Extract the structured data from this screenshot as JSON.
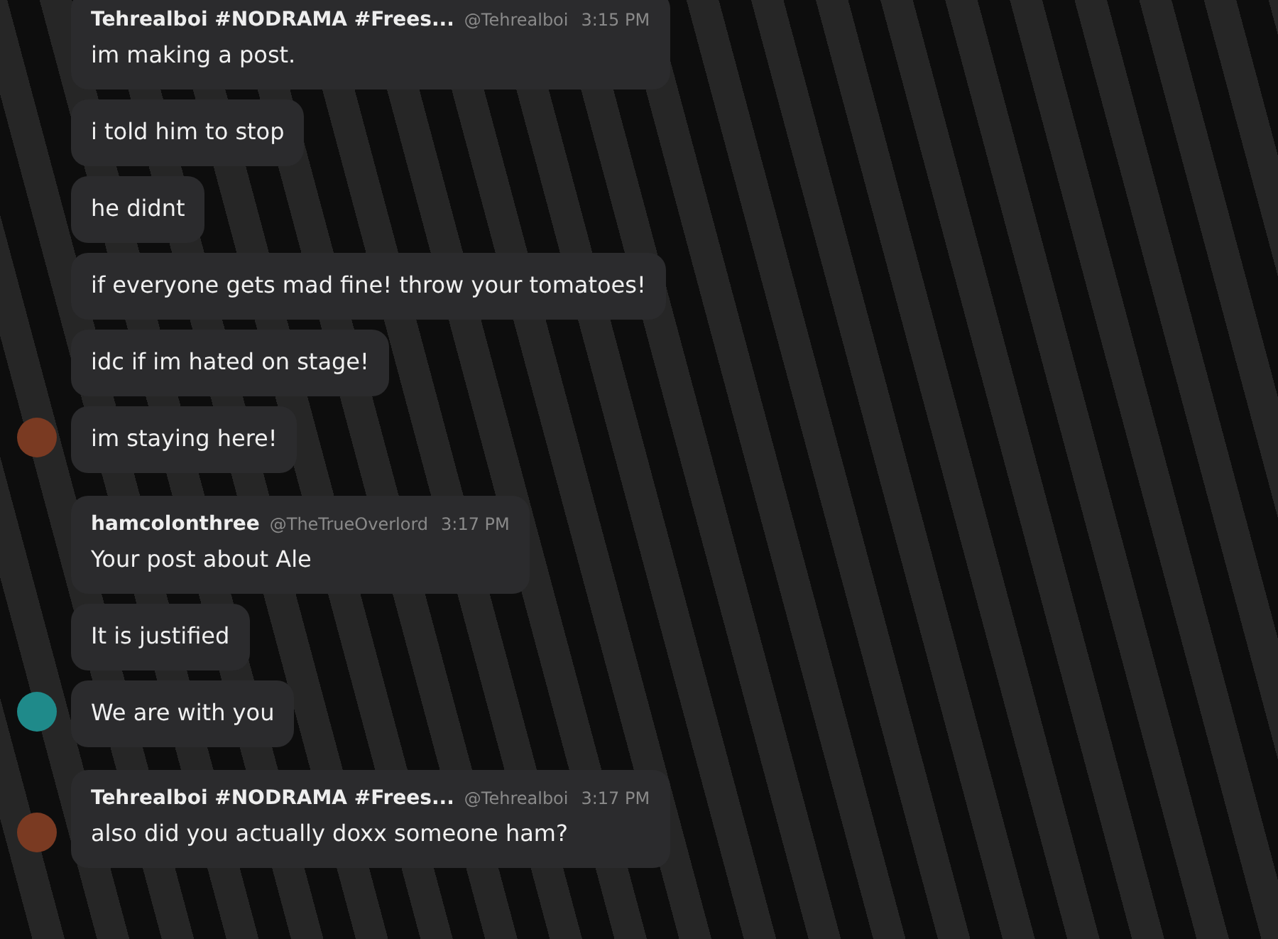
{
  "message_groups": [
    {
      "display_name": "Tehrealboi #NODRAMA #Frees...",
      "handle": "@Tehrealboi",
      "time": "3:15 PM",
      "color": "#7a3a22",
      "messages": [
        "im making a post.",
        "i told him to stop",
        "he didnt",
        "if everyone gets mad fine! throw your tomatoes!",
        "idc if im hated on stage!",
        "im staying here!"
      ]
    },
    {
      "display_name": "hamcolonthree",
      "handle": "@TheTrueOverlord",
      "time": "3:17 PM",
      "color": "#1f8a8a",
      "messages": [
        "Your post about Ale",
        "It is justified",
        "We are with you"
      ]
    },
    {
      "display_name": "Tehrealboi #NODRAMA #Frees...",
      "handle": "@Tehrealboi",
      "time": "3:17 PM",
      "color": "#7a3a22",
      "messages": [
        "also did you actually doxx someone ham?"
      ]
    }
  ]
}
